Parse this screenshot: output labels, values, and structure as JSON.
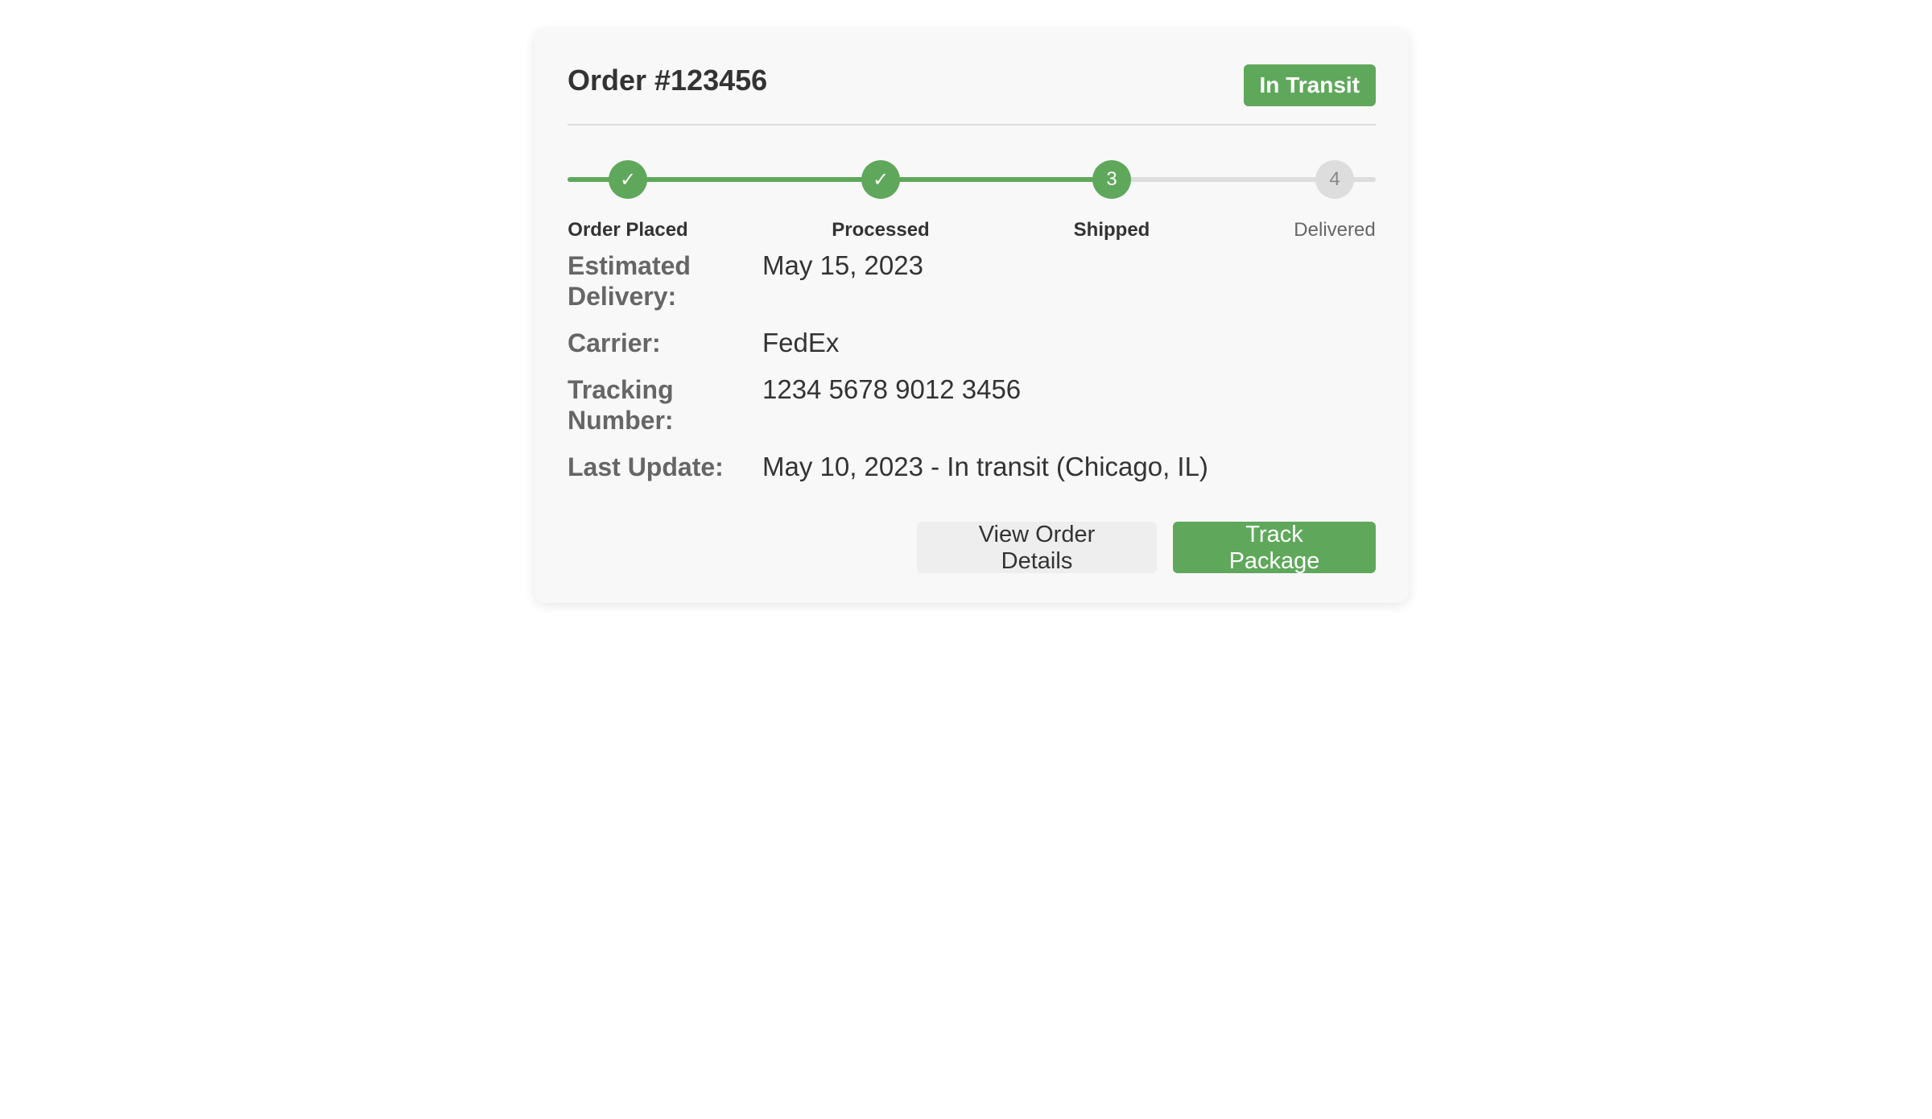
{
  "order": {
    "title": "Order #123456",
    "status": "In Transit"
  },
  "progress": {
    "completed_fraction": 0.675,
    "steps": [
      {
        "label": "Order Placed",
        "marker": "✓",
        "state": "complete"
      },
      {
        "label": "Processed",
        "marker": "✓",
        "state": "complete"
      },
      {
        "label": "Shipped",
        "marker": "3",
        "state": "current"
      },
      {
        "label": "Delivered",
        "marker": "4",
        "state": "pending"
      }
    ]
  },
  "details": [
    {
      "label": "Estimated Delivery:",
      "value": "May 15, 2023"
    },
    {
      "label": "Carrier:",
      "value": "FedEx"
    },
    {
      "label": "Tracking Number:",
      "value": "1234 5678 9012 3456"
    },
    {
      "label": "Last Update:",
      "value": "May 10, 2023 - In transit (Chicago, IL)"
    }
  ],
  "actions": {
    "view_details_label": "View Order Details",
    "track_label": "Track Package"
  },
  "colors": {
    "accent": "#5fa85b",
    "pending": "#dddddd"
  }
}
